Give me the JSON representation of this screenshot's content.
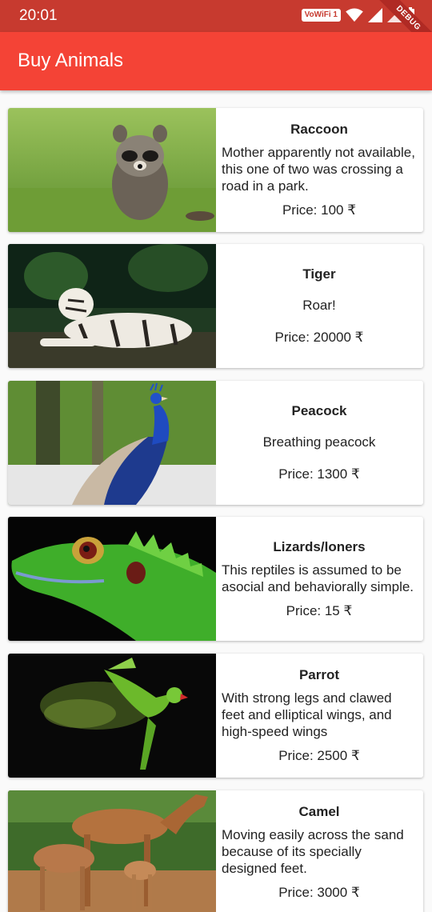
{
  "status": {
    "time": "20:01",
    "network_badge": "VoWiFi 1"
  },
  "debug_banner": "DEBUG",
  "app_bar": {
    "title": "Buy Animals"
  },
  "animals": [
    {
      "name": "Raccoon",
      "description": "Mother apparently not available, this one of two was crossing a road in a park.",
      "price": "Price: 100 ₹",
      "image": "raccoon-photo"
    },
    {
      "name": "Tiger",
      "description": "Roar!",
      "price": "Price: 20000 ₹",
      "image": "white-tiger-photo"
    },
    {
      "name": "Peacock",
      "description": "Breathing peacock",
      "price": "Price: 1300 ₹",
      "image": "peacock-photo"
    },
    {
      "name": "Lizards/loners",
      "description": "This reptiles is assumed to be asocial and behaviorally simple.",
      "price": "Price: 15 ₹",
      "image": "green-lizard-photo"
    },
    {
      "name": "Parrot",
      "description": "With strong legs and clawed feet and elliptical wings, and high-speed wings",
      "price": "Price: 2500 ₹",
      "image": "parrot-photo"
    },
    {
      "name": "Camel",
      "description": "Moving easily across the sand because of its specially designed feet.",
      "price": "Price: 3000 ₹",
      "image": "camel-photo"
    }
  ]
}
